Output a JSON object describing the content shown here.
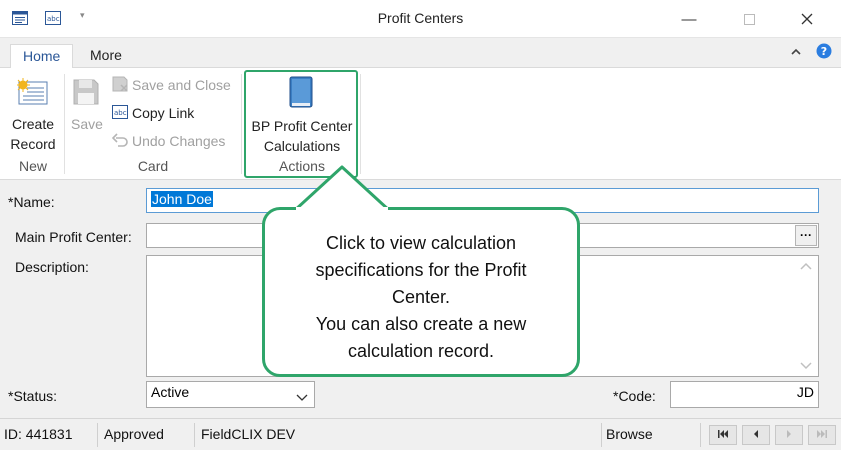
{
  "window": {
    "title": "Profit Centers",
    "controls": {
      "minimize": "—",
      "maximize": "☐",
      "close": "✕"
    }
  },
  "ribbon": {
    "tabs": [
      {
        "label": "Home",
        "active": true
      },
      {
        "label": "More",
        "active": false
      }
    ],
    "collapse_icon": "chevron-up-icon",
    "help_icon": "help-icon",
    "groups": {
      "new": {
        "label": "New",
        "create_record": {
          "line1": "Create",
          "line2": "Record"
        }
      },
      "card": {
        "label": "Card",
        "save": {
          "label": "Save",
          "enabled": false
        },
        "save_and_close": {
          "label": "Save and Close",
          "enabled": false
        },
        "copy_link": {
          "label": "Copy Link",
          "enabled": true
        },
        "undo_changes": {
          "label": "Undo Changes",
          "enabled": false
        }
      },
      "actions": {
        "label": "Actions",
        "bp_profit_center_calculations": {
          "line1": "BP Profit Center",
          "line2": "Calculations"
        }
      }
    }
  },
  "form": {
    "name": {
      "label": "*Name:",
      "value": "John Doe"
    },
    "main_profit_center": {
      "label": "Main Profit Center:",
      "value": "",
      "lookup_button": "···"
    },
    "description": {
      "label": "Description:",
      "value": ""
    },
    "status": {
      "label": "*Status:",
      "value": "Active"
    },
    "code": {
      "label": "*Code:",
      "value": "JD"
    }
  },
  "status_bar": {
    "id": "ID: 441831",
    "state": "Approved",
    "database": "FieldCLIX DEV",
    "mode": "Browse"
  },
  "callout": {
    "lines": [
      "Click to view calculation",
      "specifications for the Profit",
      "Center.",
      "You can also create a new",
      "calculation record."
    ]
  },
  "colors": {
    "highlight_green": "#2fa56a",
    "selection_blue": "#0078d7",
    "tab_active_text": "#2b5797",
    "book_icon_blue": "#3b7fc4"
  }
}
